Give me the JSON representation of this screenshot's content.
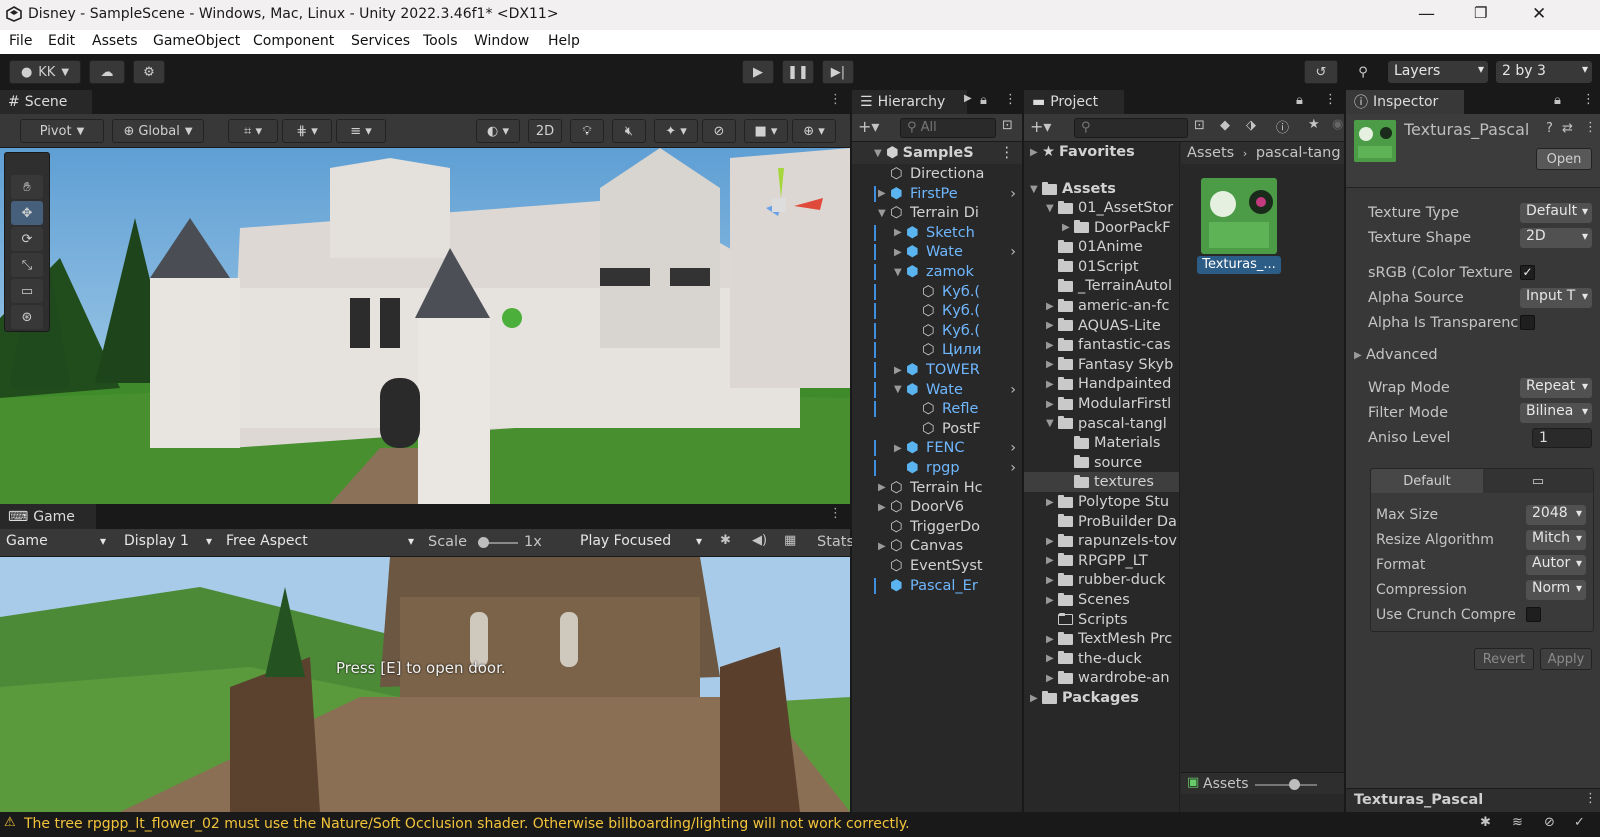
{
  "window": {
    "title": "Disney - SampleScene - Windows, Mac, Linux - Unity 2022.3.46f1* <DX11>"
  },
  "menu": [
    "File",
    "Edit",
    "Assets",
    "GameObject",
    "Component",
    "Services",
    "Tools",
    "Window",
    "Help"
  ],
  "toolbar": {
    "account": "KK",
    "layers": "Layers",
    "layout": "2 by 3"
  },
  "scene": {
    "tab": "Scene",
    "pivot": "Pivot",
    "global": "Global",
    "mode2d": "2D"
  },
  "game": {
    "tab": "Game",
    "view": "Game",
    "display": "Display 1",
    "aspect": "Free Aspect",
    "scale_label": "Scale",
    "scale_value": "1x",
    "play_mode": "Play Focused",
    "stats": "Stats",
    "hint": "Press [E] to open door."
  },
  "hierarchy": {
    "tab": "Hierarchy",
    "search": "All",
    "root": "SampleS",
    "items": [
      {
        "label": "Directiona",
        "indent": 1,
        "arrow": "",
        "blue": false,
        "icon": "cube"
      },
      {
        "label": "FirstPe",
        "indent": 1,
        "arrow": "▶",
        "blue": true,
        "icon": "prefab",
        "more": true
      },
      {
        "label": "Terrain Di",
        "indent": 1,
        "arrow": "▼",
        "blue": false,
        "icon": "cube"
      },
      {
        "label": "Sketch",
        "indent": 2,
        "arrow": "▶",
        "blue": true,
        "icon": "prefab"
      },
      {
        "label": "Wate",
        "indent": 2,
        "arrow": "▶",
        "blue": true,
        "icon": "prefab",
        "more": true
      },
      {
        "label": "zamok",
        "indent": 2,
        "arrow": "▼",
        "blue": true,
        "icon": "prefab"
      },
      {
        "label": "Куб.(",
        "indent": 3,
        "arrow": "",
        "blue": true,
        "icon": "cube"
      },
      {
        "label": "Куб.(",
        "indent": 3,
        "arrow": "",
        "blue": true,
        "icon": "cube"
      },
      {
        "label": "Куб.(",
        "indent": 3,
        "arrow": "",
        "blue": true,
        "icon": "cube"
      },
      {
        "label": "Цили",
        "indent": 3,
        "arrow": "",
        "blue": true,
        "icon": "cube"
      },
      {
        "label": "TOWER",
        "indent": 2,
        "arrow": "▶",
        "blue": true,
        "icon": "prefab"
      },
      {
        "label": "Wate",
        "indent": 2,
        "arrow": "▼",
        "blue": true,
        "icon": "prefab",
        "more": true
      },
      {
        "label": "Refle",
        "indent": 3,
        "arrow": "",
        "blue": true,
        "icon": "cube"
      },
      {
        "label": "PostF",
        "indent": 3,
        "arrow": "",
        "blue": false,
        "icon": "cube"
      },
      {
        "label": "FENC",
        "indent": 2,
        "arrow": "▶",
        "blue": true,
        "icon": "prefab",
        "more": true
      },
      {
        "label": "rpgp",
        "indent": 2,
        "arrow": "",
        "blue": true,
        "icon": "prefab",
        "more": true
      },
      {
        "label": "Terrain Hc",
        "indent": 1,
        "arrow": "▶",
        "blue": false,
        "icon": "cube"
      },
      {
        "label": "DoorV6",
        "indent": 1,
        "arrow": "▶",
        "blue": false,
        "icon": "cube"
      },
      {
        "label": "TriggerDo",
        "indent": 1,
        "arrow": "",
        "blue": false,
        "icon": "cube"
      },
      {
        "label": "Canvas",
        "indent": 1,
        "arrow": "▶",
        "blue": false,
        "icon": "cube"
      },
      {
        "label": "EventSyst",
        "indent": 1,
        "arrow": "",
        "blue": false,
        "icon": "cube"
      },
      {
        "label": "Pascal_Er",
        "indent": 1,
        "arrow": "",
        "blue": true,
        "icon": "prefab"
      }
    ]
  },
  "project": {
    "tab": "Project",
    "favorites": "Favorites",
    "assets_root": "Assets",
    "packages": "Packages",
    "tree": [
      {
        "label": "01_AssetStor",
        "indent": 1,
        "arrow": "▼",
        "open": true
      },
      {
        "label": "DoorPackF",
        "indent": 2,
        "arrow": "▶"
      },
      {
        "label": "01Anime",
        "indent": 1,
        "arrow": ""
      },
      {
        "label": "01Script",
        "indent": 1,
        "arrow": ""
      },
      {
        "label": "_TerrainAutol",
        "indent": 1,
        "arrow": ""
      },
      {
        "label": "americ-an-fc",
        "indent": 1,
        "arrow": "▶"
      },
      {
        "label": "AQUAS-Lite",
        "indent": 1,
        "arrow": "▶"
      },
      {
        "label": "fantastic-cas",
        "indent": 1,
        "arrow": "▶"
      },
      {
        "label": "Fantasy Skyb",
        "indent": 1,
        "arrow": "▶"
      },
      {
        "label": "Handpainted",
        "indent": 1,
        "arrow": "▶"
      },
      {
        "label": "ModularFirstl",
        "indent": 1,
        "arrow": "▶"
      },
      {
        "label": "pascal-tangl",
        "indent": 1,
        "arrow": "▼",
        "open": true
      },
      {
        "label": "Materials",
        "indent": 2,
        "arrow": ""
      },
      {
        "label": "source",
        "indent": 2,
        "arrow": ""
      },
      {
        "label": "textures",
        "indent": 2,
        "arrow": "",
        "selected": true
      },
      {
        "label": "Polytope Stu",
        "indent": 1,
        "arrow": "▶"
      },
      {
        "label": "ProBuilder Da",
        "indent": 1,
        "arrow": ""
      },
      {
        "label": "rapunzels-tov",
        "indent": 1,
        "arrow": "▶"
      },
      {
        "label": "RPGPP_LT",
        "indent": 1,
        "arrow": "▶"
      },
      {
        "label": "rubber-duck",
        "indent": 1,
        "arrow": "▶"
      },
      {
        "label": "Scenes",
        "indent": 1,
        "arrow": "▶"
      },
      {
        "label": "Scripts",
        "indent": 1,
        "arrow": "",
        "empty": true
      },
      {
        "label": "TextMesh Prc",
        "indent": 1,
        "arrow": "▶"
      },
      {
        "label": "the-duck",
        "indent": 1,
        "arrow": "▶"
      },
      {
        "label": "wardrobe-an",
        "indent": 1,
        "arrow": "▶"
      }
    ],
    "breadcrumb": [
      "Assets",
      "pascal-tang"
    ],
    "asset_label": "Texturas_...",
    "footer_path": "Assets"
  },
  "inspector": {
    "tab": "Inspector",
    "asset_name": "Texturas_Pascal",
    "open_button": "Open",
    "texture_type": {
      "label": "Texture Type",
      "value": "Default"
    },
    "texture_shape": {
      "label": "Texture Shape",
      "value": "2D"
    },
    "srgb": {
      "label": "sRGB (Color Texture",
      "checked": true
    },
    "alpha_source": {
      "label": "Alpha Source",
      "value": "Input T"
    },
    "alpha_transparency": {
      "label": "Alpha Is Transparenc",
      "checked": false
    },
    "advanced": "Advanced",
    "wrap_mode": {
      "label": "Wrap Mode",
      "value": "Repeat"
    },
    "filter_mode": {
      "label": "Filter Mode",
      "value": "Bilinea"
    },
    "aniso_level": {
      "label": "Aniso Level",
      "value": "1"
    },
    "platform_tab": "Default",
    "max_size": {
      "label": "Max Size",
      "value": "2048"
    },
    "resize_algorithm": {
      "label": "Resize Algorithm",
      "value": "Mitch"
    },
    "format": {
      "label": "Format",
      "value": "Autor"
    },
    "compression": {
      "label": "Compression",
      "value": "Norm"
    },
    "use_crunch": {
      "label": "Use Crunch Compre",
      "checked": false
    },
    "revert": "Revert",
    "apply": "Apply",
    "footer_name": "Texturas_Pascal"
  },
  "status": {
    "message": "The tree rpgpp_lt_flower_02 must use the Nature/Soft Occlusion shader. Otherwise billboarding/lighting will not work correctly."
  }
}
